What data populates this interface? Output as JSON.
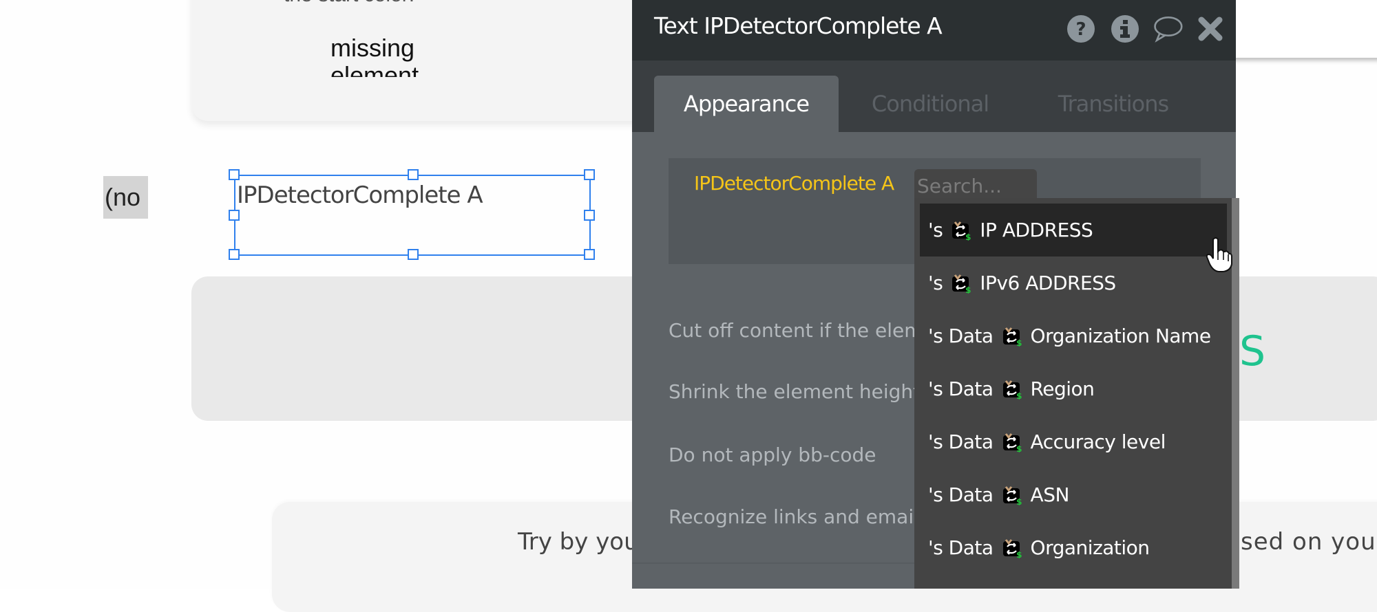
{
  "canvas": {
    "top_card": {
      "partial_heading": "the start color:",
      "missing_line1": "missing",
      "missing_line2": "element"
    },
    "no_label": "(no",
    "selected_element": {
      "text": "IPDetectorComplete A"
    },
    "gray_card_text": "S",
    "bottom_card": {
      "left_text": "Try by you",
      "right_text": "sed on your"
    }
  },
  "panel": {
    "title": "Text IPDetectorComplete A",
    "header_icons": [
      "help-icon",
      "info-icon",
      "comment-icon",
      "close-icon"
    ],
    "tabs": [
      {
        "label": "Appearance",
        "active": true
      },
      {
        "label": "Conditional",
        "active": false
      },
      {
        "label": "Transitions",
        "active": false
      }
    ],
    "expression": {
      "source_label": "IPDetectorComplete A",
      "search_placeholder": "Search..."
    },
    "options": [
      "Cut off content if the element is too small",
      "Shrink the element height to fit content",
      "Do not apply bb-code",
      "Recognize links and emails"
    ],
    "dropdown": {
      "highlighted_index": 0,
      "items": [
        {
          "prefix": "'s",
          "icon": "api-connector-icon",
          "label": "IP ADDRESS"
        },
        {
          "prefix": "'s",
          "icon": "api-connector-icon",
          "label": "IPv6 ADDRESS"
        },
        {
          "prefix": "'s Data",
          "icon": "api-connector-icon",
          "label": "Organization Name"
        },
        {
          "prefix": "'s Data",
          "icon": "api-connector-icon",
          "label": "Region"
        },
        {
          "prefix": "'s Data",
          "icon": "api-connector-icon",
          "label": "Accuracy level"
        },
        {
          "prefix": "'s Data",
          "icon": "api-connector-icon",
          "label": "ASN"
        },
        {
          "prefix": "'s Data",
          "icon": "api-connector-icon",
          "label": "Organization"
        }
      ]
    }
  },
  "colors": {
    "header_bg": "#2b3032",
    "panel_bg": "#5e6367",
    "accent_yellow": "#f5c518",
    "selection_blue": "#2f80ed",
    "green_text": "#1fc38e"
  }
}
